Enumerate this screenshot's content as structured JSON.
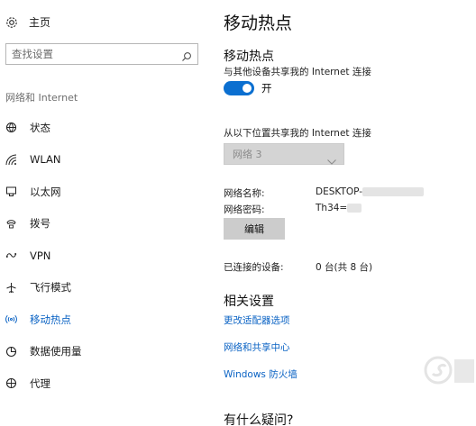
{
  "sidebar": {
    "home_label": "主页",
    "search_placeholder": "查找设置",
    "section_label": "网络和 Internet",
    "items": [
      {
        "label": "状态",
        "icon": "globe-status-icon"
      },
      {
        "label": "WLAN",
        "icon": "wifi-icon"
      },
      {
        "label": "以太网",
        "icon": "ethernet-icon"
      },
      {
        "label": "拨号",
        "icon": "dialup-icon"
      },
      {
        "label": "VPN",
        "icon": "vpn-icon"
      },
      {
        "label": "飞行模式",
        "icon": "airplane-icon"
      },
      {
        "label": "移动热点",
        "icon": "hotspot-icon",
        "active": true
      },
      {
        "label": "数据使用量",
        "icon": "data-usage-icon"
      },
      {
        "label": "代理",
        "icon": "proxy-icon"
      }
    ]
  },
  "main": {
    "title": "移动热点",
    "section_title": "移动热点",
    "section_desc": "与其他设备共享我的 Internet 连接",
    "toggle_state": "开",
    "share_from_label": "从以下位置共享我的 Internet 连接",
    "share_from_value": "网络 3",
    "network_name_label": "网络名称:",
    "network_name_value": "DESKTOP-",
    "network_password_label": "网络密码:",
    "network_password_value": "Th34=",
    "edit_button": "编辑",
    "connected_label": "已连接的设备:",
    "connected_value": "0 台(共 8 台)",
    "related_title": "相关设置",
    "links": [
      "更改适配器选项",
      "网络和共享中心",
      "Windows 防火墙"
    ],
    "question": "有什么疑问?"
  },
  "colors": {
    "accent": "#0b63c4",
    "toggle_on": "#0b6fd0",
    "disabled_dropdown": "#d4d4d4",
    "button": "#cccccc"
  }
}
